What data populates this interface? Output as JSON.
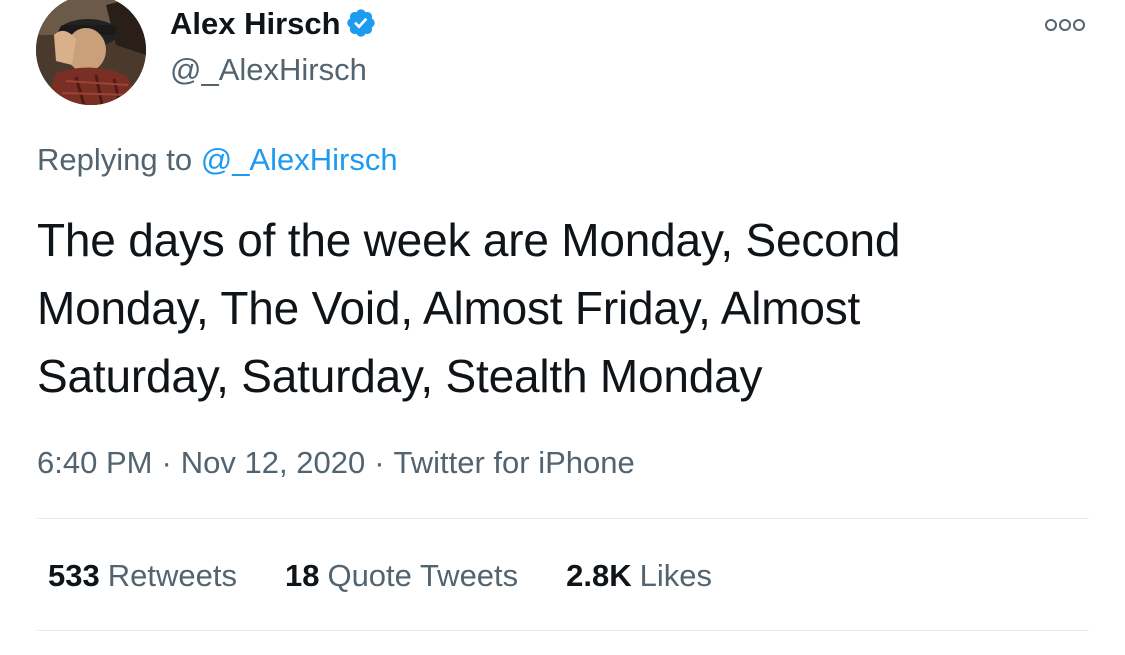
{
  "author": {
    "display_name": "Alex Hirsch",
    "handle": "@_AlexHirsch",
    "verified": true,
    "avatar_icon": "profile-photo",
    "verified_icon": "verified-badge-icon"
  },
  "more_menu": {
    "icon": "more-options-icon"
  },
  "reply_context": {
    "prefix": "Replying to",
    "mention": "@_AlexHirsch"
  },
  "tweet": {
    "text": "The days of the week are Monday, Second Monday, The Void, Almost Friday, Almost Saturday, Saturday, Stealth Monday"
  },
  "meta": {
    "time": "6:40 PM",
    "separator": "·",
    "date": "Nov 12, 2020",
    "source": "Twitter for iPhone"
  },
  "stats": [
    {
      "count": "533",
      "label": "Retweets"
    },
    {
      "count": "18",
      "label": "Quote Tweets"
    },
    {
      "count": "2.8K",
      "label": "Likes"
    }
  ],
  "colors": {
    "text_primary": "#0f1419",
    "text_secondary": "#536471",
    "accent_blue": "#1d9bf0",
    "divider": "#e6ecf0"
  }
}
